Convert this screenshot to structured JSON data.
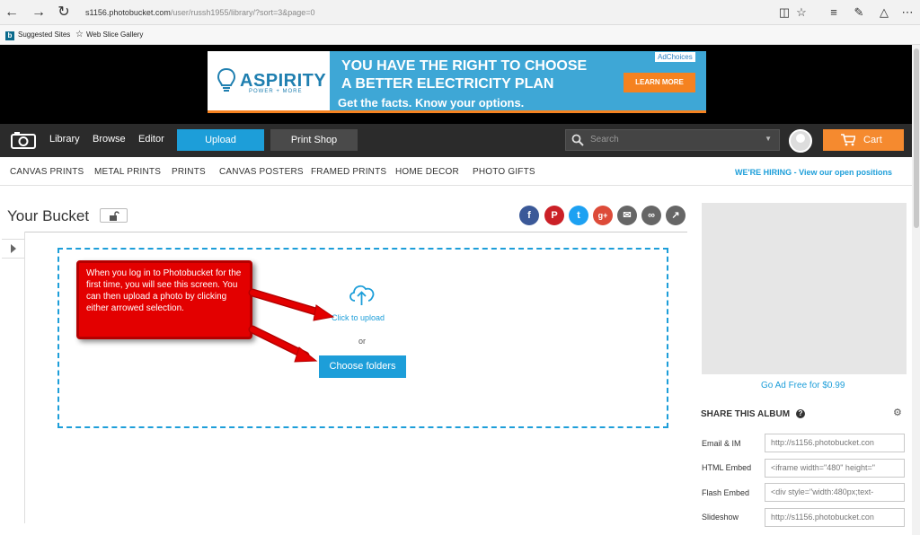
{
  "browser": {
    "url_domain": "s1156.photobucket.com",
    "url_path": "/user/russh1955/library/?sort=3&page=0",
    "favorites": [
      "Suggested Sites",
      "Web Slice Gallery"
    ]
  },
  "ad": {
    "brand": "ASPIRITY",
    "brand_sub": "POWER + MORE",
    "headline_1": "YOU HAVE THE RIGHT TO CHOOSE",
    "headline_2": "A BETTER ELECTRICITY PLAN",
    "tagline": "Get the facts. Know your options.",
    "cta": "LEARN MORE",
    "choices": "AdChoices"
  },
  "nav": {
    "library": "Library",
    "browse": "Browse",
    "editor": "Editor",
    "upload": "Upload",
    "print_shop": "Print Shop",
    "search_placeholder": "Search",
    "cart": "Cart"
  },
  "categories": [
    "CANVAS PRINTS",
    "METAL PRINTS",
    "PRINTS",
    "CANVAS POSTERS",
    "FRAMED PRINTS",
    "HOME DECOR",
    "PHOTO GIFTS"
  ],
  "hiring": "WE'RE HIRING - View our open positions",
  "main": {
    "title": "Your Bucket",
    "click_to_upload": "Click to upload",
    "or": "or",
    "choose_folders": "Choose folders"
  },
  "callout_text": "When you log in to Photobucket for the first time, you will see this screen. You can then upload a photo by clicking either arrowed selection.",
  "rail": {
    "ad_free": "Go Ad Free for $0.99",
    "share_title": "SHARE THIS ALBUM",
    "share_rows": [
      {
        "label": "Email & IM",
        "value": "http://s1156.photobucket.con"
      },
      {
        "label": "HTML Embed",
        "value": "<iframe width=\"480\" height=\""
      },
      {
        "label": "Flash Embed",
        "value": "<div style=\"width:480px;text-"
      },
      {
        "label": "Slideshow",
        "value": "http://s1156.photobucket.con"
      }
    ]
  },
  "colors": {
    "accent_blue": "#1d9ed9",
    "cart_orange": "#f58a2f",
    "callout_red": "#e30000",
    "nav_dark": "#2b2b2b"
  }
}
